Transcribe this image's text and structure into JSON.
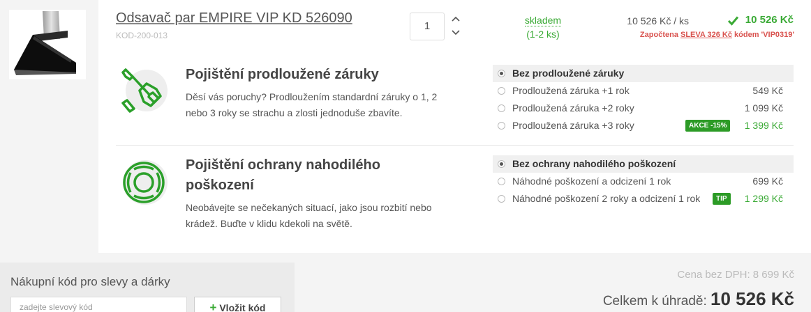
{
  "product": {
    "name": "Odsavač par EMPIRE VIP KD 526090",
    "code": "KOD-200-013",
    "quantity": "1",
    "stock_label": "skladem",
    "stock_count": "(1-2 ks)",
    "unit_price": "10 526 Kč / ks",
    "total_price": "10 526 Kč",
    "discount_prefix": "Započtena",
    "discount_link": "SLEVA 326 Kč",
    "discount_suffix": "kódem 'VIP0319'"
  },
  "warranty": {
    "title": "Pojištění prodloužené záruky",
    "desc_line1": "Děsí vás poruchy? Prodloužením standardní záruky o 1, 2",
    "desc_line2": "nebo 3 roky se strachu a zlosti jednoduše zbavíte.",
    "options": [
      {
        "label": "Bez prodloužené záruky",
        "price": ""
      },
      {
        "label": "Prodloužená záruka +1 rok",
        "price": "549 Kč"
      },
      {
        "label": "Prodloužená záruka +2 roky",
        "price": "1 099 Kč"
      },
      {
        "label": "Prodloužená záruka +3 roky",
        "price": "1 399 Kč",
        "badge": "AKCE -15%"
      }
    ]
  },
  "damage": {
    "title_line1": "Pojištění ochrany nahodilého",
    "title_line2": "poškození",
    "desc_line1": "Neobávejte se nečekaných situací, jako jsou rozbití nebo",
    "desc_line2": "krádež. Buďte v klidu kdekoli na světě.",
    "options": [
      {
        "label": "Bez ochrany nahodilého poškození",
        "price": ""
      },
      {
        "label": "Náhodné poškození a odcizení 1 rok",
        "price": "699 Kč"
      },
      {
        "label": "Náhodné poškození 2 roky a odcizení 1 rok",
        "price": "1 299 Kč",
        "badge": "TIP"
      }
    ]
  },
  "promo": {
    "title": "Nákupní kód pro slevy a dárky",
    "placeholder": "zadejte slevový kód",
    "button": "Vložit kód"
  },
  "summary": {
    "no_vat": "Cena bez DPH: 8 699 Kč",
    "total_label": "Celkem k úhradě:",
    "total_value": "10 526 Kč"
  },
  "colors": {
    "accent_green": "#3aaa35",
    "badge_green": "#2c9b26",
    "discount_red": "#d9534f"
  },
  "icons": [
    "range-hood-product-image",
    "chevron-up-icon",
    "chevron-down-icon",
    "check-icon",
    "wrench-hand-icon",
    "lifebuoy-icon",
    "plus-icon"
  ]
}
